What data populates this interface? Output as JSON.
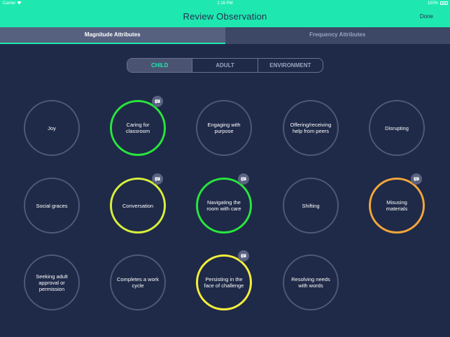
{
  "status": {
    "carrier": "Carrier",
    "time": "1:16 PM",
    "battery": "100%"
  },
  "header": {
    "title": "Review Observation",
    "done_label": "Done"
  },
  "tabs": [
    {
      "label": "Magnitude Attributes",
      "active": true
    },
    {
      "label": "Frequency Attributes",
      "active": false
    }
  ],
  "filter": {
    "options": [
      "CHILD",
      "ADULT",
      "ENVIRONMENT"
    ],
    "selected": "CHILD"
  },
  "colors": {
    "accent": "#1ee8b0",
    "green": "#27e63c",
    "lime": "#d7f03a",
    "orange": "#f4a63a",
    "yellow": "#f6ef3c",
    "background": "#1f2a48"
  },
  "attributes": [
    {
      "label": "Joy",
      "rating": "none",
      "has_note": false
    },
    {
      "label": "Caring for\nclassroom",
      "rating": "green",
      "has_note": true
    },
    {
      "label": "Engaging with\npurpose",
      "rating": "none",
      "has_note": false
    },
    {
      "label": "Offering/receiving\nhelp from peers",
      "rating": "none",
      "has_note": false
    },
    {
      "label": "Disrupting",
      "rating": "none",
      "has_note": false
    },
    {
      "label": "Social graces",
      "rating": "none",
      "has_note": false
    },
    {
      "label": "Conversation",
      "rating": "lime",
      "has_note": true
    },
    {
      "label": "Navigating the\nroom with care",
      "rating": "green",
      "has_note": true
    },
    {
      "label": "Shifting",
      "rating": "none",
      "has_note": false
    },
    {
      "label": "Misusing\nmaterials",
      "rating": "orange",
      "has_note": true
    },
    {
      "label": "Seeking adult\napproval or\npermission",
      "rating": "none",
      "has_note": false
    },
    {
      "label": "Completes a work\ncycle",
      "rating": "none",
      "has_note": false
    },
    {
      "label": "Persisting in the\nface of challenge",
      "rating": "yellow",
      "has_note": true
    },
    {
      "label": "Resolving needs\nwith words",
      "rating": "none",
      "has_note": false
    }
  ]
}
